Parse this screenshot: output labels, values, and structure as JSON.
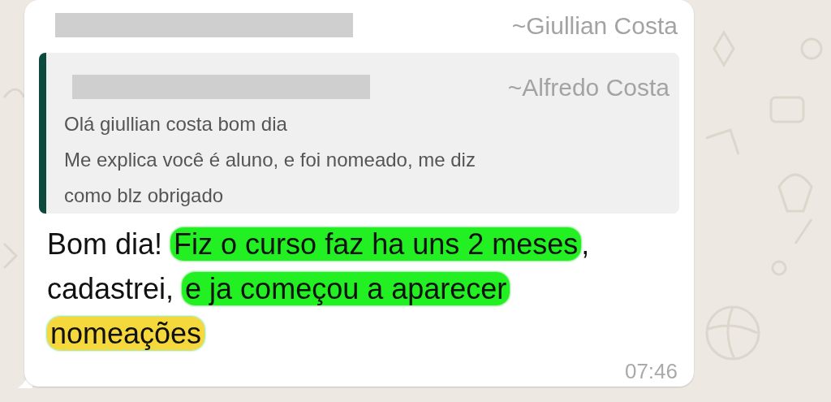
{
  "message": {
    "sender": "~Giullian Costa",
    "quote": {
      "sender": "~Alfredo Costa",
      "lines": [
        "Olá giullian costa bom dia",
        "Me explica você é aluno, e foi nomeado, me diz",
        "como blz obrigado"
      ]
    },
    "segments": [
      {
        "text": "Bom dia! ",
        "highlighted": false
      },
      {
        "text": "Fiz o curso faz ha uns 2 meses",
        "highlighted": true,
        "color": "#22f022"
      },
      {
        "text": ", cadastrei, ",
        "highlighted": false
      },
      {
        "text": "e ja começou a aparecer ",
        "highlighted": true,
        "color": "#22f022"
      },
      {
        "text": "nomeações",
        "highlighted": true,
        "color": "#f5d83c"
      }
    ],
    "time": "07:46"
  }
}
